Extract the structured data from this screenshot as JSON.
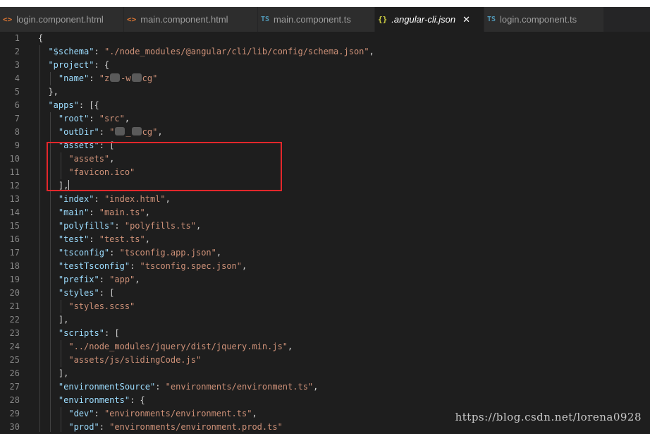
{
  "tabs": [
    {
      "icon": "<>",
      "label": "login.component.html"
    },
    {
      "icon": "<>",
      "label": "main.component.html"
    },
    {
      "icon": "TS",
      "label": "main.component.ts"
    },
    {
      "icon": "{}",
      "label": ".angular-cli.json",
      "active": true
    },
    {
      "icon": "TS",
      "label": "login.component.ts"
    }
  ],
  "editor": {
    "lines": [
      {
        "n": "1",
        "segs": [
          {
            "t": "{",
            "c": "p"
          }
        ]
      },
      {
        "n": "2",
        "segs": [
          {
            "t": "  ",
            "c": "p"
          },
          {
            "t": "\"$schema\"",
            "c": "key"
          },
          {
            "t": ": ",
            "c": "p"
          },
          {
            "t": "\"./node_modules/@angular/cli/lib/config/schema.json\"",
            "c": "str"
          },
          {
            "t": ",",
            "c": "p"
          }
        ]
      },
      {
        "n": "3",
        "segs": [
          {
            "t": "  ",
            "c": "p"
          },
          {
            "t": "\"project\"",
            "c": "key"
          },
          {
            "t": ": {",
            "c": "p"
          }
        ]
      },
      {
        "n": "4",
        "segs": [
          {
            "t": "    ",
            "c": "p"
          },
          {
            "t": "\"name\"",
            "c": "key"
          },
          {
            "t": ": ",
            "c": "p"
          },
          {
            "t": "\"z",
            "c": "str"
          },
          {
            "blur": true
          },
          {
            "t": "-w",
            "c": "str"
          },
          {
            "blur": true
          },
          {
            "t": "cg\"",
            "c": "str"
          }
        ]
      },
      {
        "n": "5",
        "segs": [
          {
            "t": "  },",
            "c": "p"
          }
        ]
      },
      {
        "n": "6",
        "segs": [
          {
            "t": "  ",
            "c": "p"
          },
          {
            "t": "\"apps\"",
            "c": "key"
          },
          {
            "t": ": [{",
            "c": "p"
          }
        ]
      },
      {
        "n": "7",
        "segs": [
          {
            "t": "    ",
            "c": "p"
          },
          {
            "t": "\"root\"",
            "c": "key"
          },
          {
            "t": ": ",
            "c": "p"
          },
          {
            "t": "\"src\"",
            "c": "str"
          },
          {
            "t": ",",
            "c": "p"
          }
        ]
      },
      {
        "n": "8",
        "segs": [
          {
            "t": "    ",
            "c": "p"
          },
          {
            "t": "\"outDir\"",
            "c": "key"
          },
          {
            "t": ": ",
            "c": "p"
          },
          {
            "t": "\"",
            "c": "str"
          },
          {
            "blur": true
          },
          {
            "t": "_",
            "c": "str"
          },
          {
            "blur": true
          },
          {
            "t": "cg\"",
            "c": "str"
          },
          {
            "t": ",",
            "c": "p"
          }
        ]
      },
      {
        "n": "9",
        "segs": [
          {
            "t": "    ",
            "c": "p"
          },
          {
            "t": "\"assets\"",
            "c": "key"
          },
          {
            "t": ": [",
            "c": "p"
          }
        ]
      },
      {
        "n": "10",
        "segs": [
          {
            "t": "      ",
            "c": "p"
          },
          {
            "t": "\"assets\"",
            "c": "str"
          },
          {
            "t": ",",
            "c": "p"
          }
        ]
      },
      {
        "n": "11",
        "segs": [
          {
            "t": "      ",
            "c": "p"
          },
          {
            "t": "\"favicon.ico\"",
            "c": "str"
          }
        ]
      },
      {
        "n": "12",
        "segs": [
          {
            "t": "    ],",
            "c": "p"
          },
          {
            "cursor": true
          }
        ]
      },
      {
        "n": "13",
        "segs": [
          {
            "t": "    ",
            "c": "p"
          },
          {
            "t": "\"index\"",
            "c": "key"
          },
          {
            "t": ": ",
            "c": "p"
          },
          {
            "t": "\"index.html\"",
            "c": "str"
          },
          {
            "t": ",",
            "c": "p"
          }
        ]
      },
      {
        "n": "14",
        "segs": [
          {
            "t": "    ",
            "c": "p"
          },
          {
            "t": "\"main\"",
            "c": "key"
          },
          {
            "t": ": ",
            "c": "p"
          },
          {
            "t": "\"main.ts\"",
            "c": "str"
          },
          {
            "t": ",",
            "c": "p"
          }
        ]
      },
      {
        "n": "15",
        "segs": [
          {
            "t": "    ",
            "c": "p"
          },
          {
            "t": "\"polyfills\"",
            "c": "key"
          },
          {
            "t": ": ",
            "c": "p"
          },
          {
            "t": "\"polyfills.ts\"",
            "c": "str"
          },
          {
            "t": ",",
            "c": "p"
          }
        ]
      },
      {
        "n": "16",
        "segs": [
          {
            "t": "    ",
            "c": "p"
          },
          {
            "t": "\"test\"",
            "c": "key"
          },
          {
            "t": ": ",
            "c": "p"
          },
          {
            "t": "\"test.ts\"",
            "c": "str"
          },
          {
            "t": ",",
            "c": "p"
          }
        ]
      },
      {
        "n": "17",
        "segs": [
          {
            "t": "    ",
            "c": "p"
          },
          {
            "t": "\"tsconfig\"",
            "c": "key"
          },
          {
            "t": ": ",
            "c": "p"
          },
          {
            "t": "\"tsconfig.app.json\"",
            "c": "str"
          },
          {
            "t": ",",
            "c": "p"
          }
        ]
      },
      {
        "n": "18",
        "segs": [
          {
            "t": "    ",
            "c": "p"
          },
          {
            "t": "\"testTsconfig\"",
            "c": "key"
          },
          {
            "t": ": ",
            "c": "p"
          },
          {
            "t": "\"tsconfig.spec.json\"",
            "c": "str"
          },
          {
            "t": ",",
            "c": "p"
          }
        ]
      },
      {
        "n": "19",
        "segs": [
          {
            "t": "    ",
            "c": "p"
          },
          {
            "t": "\"prefix\"",
            "c": "key"
          },
          {
            "t": ": ",
            "c": "p"
          },
          {
            "t": "\"app\"",
            "c": "str"
          },
          {
            "t": ",",
            "c": "p"
          }
        ]
      },
      {
        "n": "20",
        "segs": [
          {
            "t": "    ",
            "c": "p"
          },
          {
            "t": "\"styles\"",
            "c": "key"
          },
          {
            "t": ": [",
            "c": "p"
          }
        ]
      },
      {
        "n": "21",
        "segs": [
          {
            "t": "      ",
            "c": "p"
          },
          {
            "t": "\"styles.scss\"",
            "c": "str"
          }
        ]
      },
      {
        "n": "22",
        "segs": [
          {
            "t": "    ],",
            "c": "p"
          }
        ]
      },
      {
        "n": "23",
        "segs": [
          {
            "t": "    ",
            "c": "p"
          },
          {
            "t": "\"scripts\"",
            "c": "key"
          },
          {
            "t": ": [",
            "c": "p"
          }
        ]
      },
      {
        "n": "24",
        "segs": [
          {
            "t": "      ",
            "c": "p"
          },
          {
            "t": "\"../node_modules/jquery/dist/jquery.min.js\"",
            "c": "str"
          },
          {
            "t": ",",
            "c": "p"
          }
        ]
      },
      {
        "n": "25",
        "segs": [
          {
            "t": "      ",
            "c": "p"
          },
          {
            "t": "\"assets/js/slidingCode.js\"",
            "c": "str"
          }
        ]
      },
      {
        "n": "26",
        "segs": [
          {
            "t": "    ],",
            "c": "p"
          }
        ]
      },
      {
        "n": "27",
        "segs": [
          {
            "t": "    ",
            "c": "p"
          },
          {
            "t": "\"environmentSource\"",
            "c": "key"
          },
          {
            "t": ": ",
            "c": "p"
          },
          {
            "t": "\"environments/environment.ts\"",
            "c": "str"
          },
          {
            "t": ",",
            "c": "p"
          }
        ]
      },
      {
        "n": "28",
        "segs": [
          {
            "t": "    ",
            "c": "p"
          },
          {
            "t": "\"environments\"",
            "c": "key"
          },
          {
            "t": ": {",
            "c": "p"
          }
        ]
      },
      {
        "n": "29",
        "segs": [
          {
            "t": "      ",
            "c": "p"
          },
          {
            "t": "\"dev\"",
            "c": "key"
          },
          {
            "t": ": ",
            "c": "p"
          },
          {
            "t": "\"environments/environment.ts\"",
            "c": "str"
          },
          {
            "t": ",",
            "c": "p"
          }
        ]
      },
      {
        "n": "30",
        "segs": [
          {
            "t": "      ",
            "c": "p"
          },
          {
            "t": "\"prod\"",
            "c": "key"
          },
          {
            "t": ": ",
            "c": "p"
          },
          {
            "t": "\"environments/environment.prod.ts\"",
            "c": "str"
          }
        ]
      }
    ]
  },
  "watermark": "https://blog.csdn.net/lorena0928",
  "colors": {
    "key": "#9cdcfe",
    "string": "#ce9178",
    "highlight": "#e3272b"
  }
}
